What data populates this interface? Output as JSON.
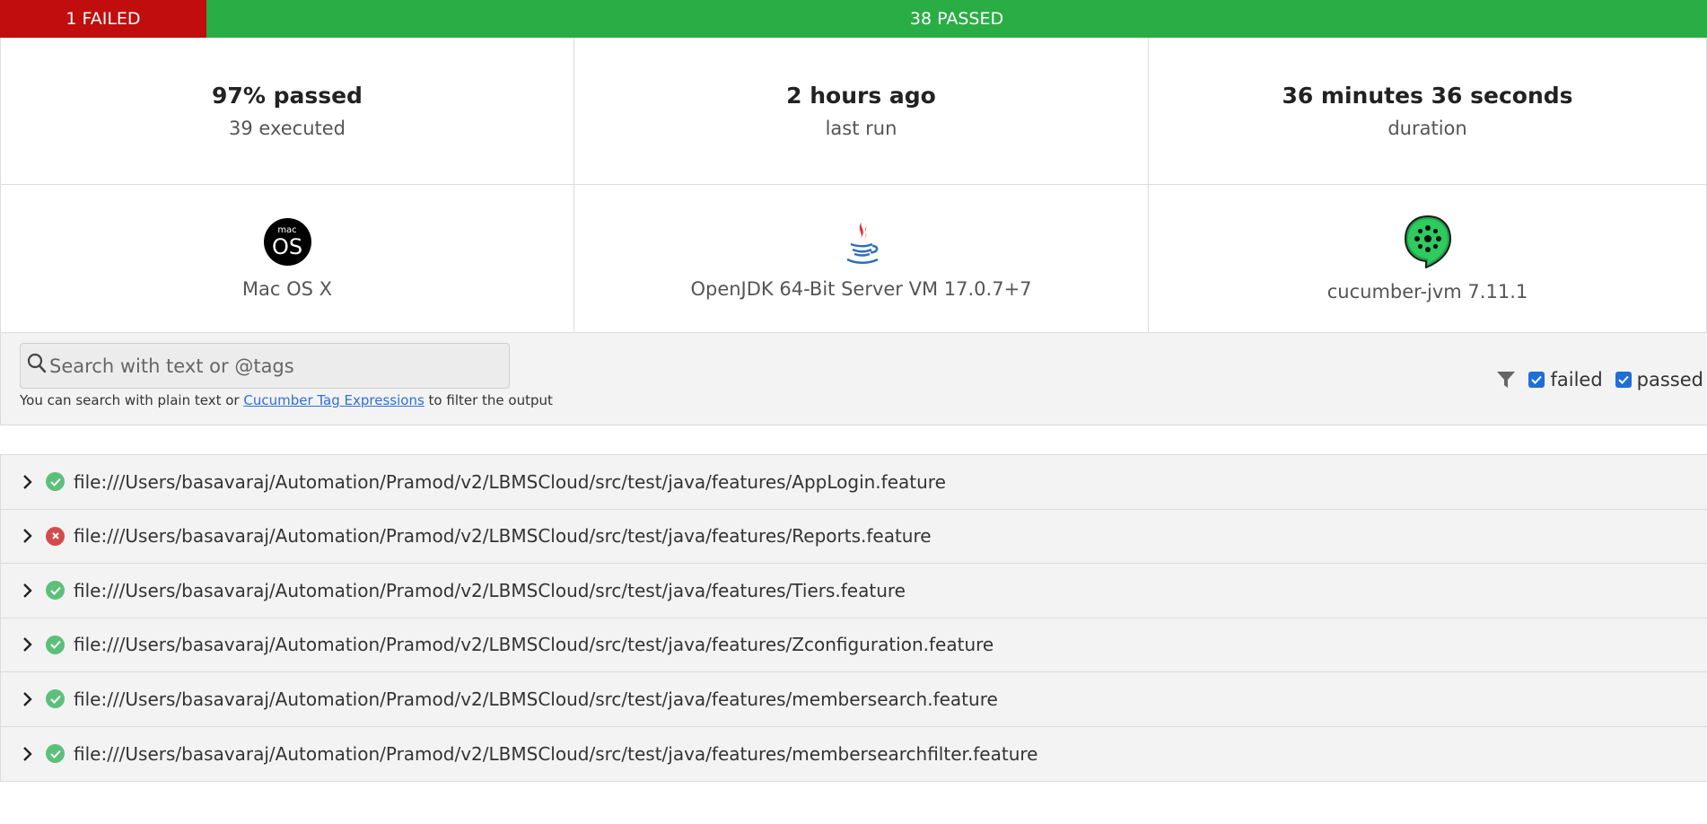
{
  "summary_bar": {
    "failed_label": "1 FAILED",
    "passed_label": "38 PASSED",
    "failed_fraction": 0.026,
    "failed_color": "#c10d0d",
    "passed_color": "#2aad45"
  },
  "stats": [
    {
      "value": "97% passed",
      "label": "39 executed"
    },
    {
      "value": "2 hours ago",
      "label": "last run"
    },
    {
      "value": "36 minutes 36 seconds",
      "label": "duration"
    }
  ],
  "environment": [
    {
      "icon": "macos-icon",
      "logo_small": "mac",
      "logo_big": "OS",
      "label": "Mac OS X"
    },
    {
      "icon": "java-icon",
      "label": "OpenJDK 64-Bit Server VM 17.0.7+7"
    },
    {
      "icon": "cucumber-icon",
      "label": "cucumber-jvm 7.11.1"
    }
  ],
  "search": {
    "placeholder": "Search with text or @tags",
    "value": "",
    "help_prefix": "You can search with plain text or ",
    "help_link": "Cucumber Tag Expressions",
    "help_suffix": " to filter the output"
  },
  "filters": {
    "icon": "filter-icon",
    "failed_label": "failed",
    "failed_checked": true,
    "passed_label": "passed",
    "passed_checked": true
  },
  "features": [
    {
      "status": "passed",
      "path": "file:///Users/basavaraj/Automation/Pramod/v2/LBMSCloud/src/test/java/features/AppLogin.feature"
    },
    {
      "status": "failed",
      "path": "file:///Users/basavaraj/Automation/Pramod/v2/LBMSCloud/src/test/java/features/Reports.feature"
    },
    {
      "status": "passed",
      "path": "file:///Users/basavaraj/Automation/Pramod/v2/LBMSCloud/src/test/java/features/Tiers.feature"
    },
    {
      "status": "passed",
      "path": "file:///Users/basavaraj/Automation/Pramod/v2/LBMSCloud/src/test/java/features/Zconfiguration.feature"
    },
    {
      "status": "passed",
      "path": "file:///Users/basavaraj/Automation/Pramod/v2/LBMSCloud/src/test/java/features/membersearch.feature"
    },
    {
      "status": "passed",
      "path": "file:///Users/basavaraj/Automation/Pramod/v2/LBMSCloud/src/test/java/features/membersearchfilter.feature"
    }
  ]
}
